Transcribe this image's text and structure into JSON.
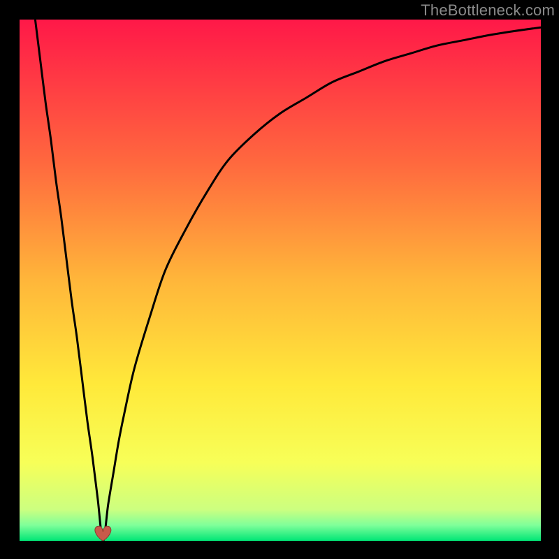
{
  "watermark": "TheBottleneck.com",
  "colors": {
    "frame": "#000000",
    "curve_stroke": "#000000",
    "marker_fill": "#c85a4a",
    "marker_stroke": "#8c3a2e",
    "watermark": "#8a8a8a",
    "gradient_stops": [
      {
        "offset": 0.0,
        "color": "#ff1848"
      },
      {
        "offset": 0.28,
        "color": "#ff6a3e"
      },
      {
        "offset": 0.5,
        "color": "#ffb63a"
      },
      {
        "offset": 0.7,
        "color": "#ffe93a"
      },
      {
        "offset": 0.85,
        "color": "#f7ff58"
      },
      {
        "offset": 0.94,
        "color": "#ccff80"
      },
      {
        "offset": 0.97,
        "color": "#7fff9a"
      },
      {
        "offset": 1.0,
        "color": "#00e676"
      }
    ]
  },
  "chart_data": {
    "type": "line",
    "title": "",
    "xlabel": "",
    "ylabel": "",
    "xlim": [
      0,
      100
    ],
    "ylim": [
      0,
      100
    ],
    "minimum_x": 16,
    "series": [
      {
        "name": "bottleneck-curve",
        "x": [
          3,
          4,
          5,
          6,
          7,
          8,
          9,
          10,
          11,
          12,
          13,
          14,
          15,
          16,
          17,
          18,
          19,
          20,
          22,
          25,
          28,
          32,
          36,
          40,
          45,
          50,
          55,
          60,
          65,
          70,
          75,
          80,
          85,
          90,
          95,
          100
        ],
        "values": [
          100,
          92,
          84,
          77,
          69,
          62,
          54,
          46,
          39,
          31,
          23,
          16,
          8,
          0,
          7,
          13,
          19,
          24,
          33,
          43,
          52,
          60,
          67,
          73,
          78,
          82,
          85,
          88,
          90,
          92,
          93.5,
          95,
          96,
          97,
          97.8,
          98.5
        ]
      }
    ],
    "annotations": [
      {
        "name": "min-marker",
        "x": 16,
        "y": 0,
        "shape": "heart"
      }
    ]
  }
}
